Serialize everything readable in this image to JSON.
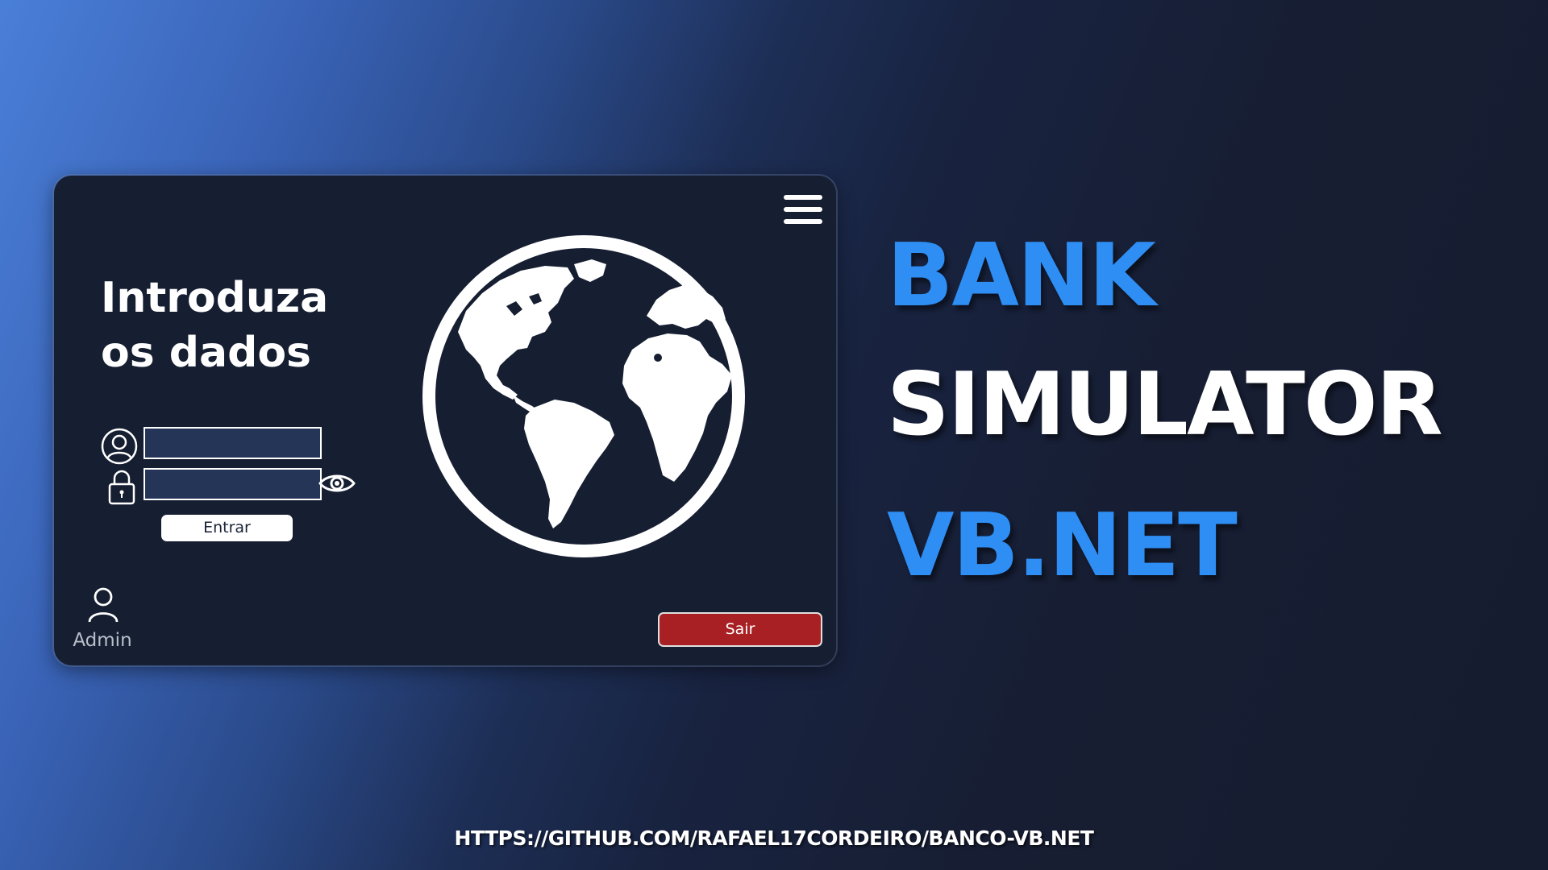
{
  "login_window": {
    "title_line1": "Introduza",
    "title_line2": "os dados",
    "username_value": "",
    "password_value": "",
    "enter_button": "Entrar",
    "admin_label": "Admin",
    "exit_button": "Sair",
    "icons": {
      "menu": "hamburger-menu-icon",
      "username": "user-circle-icon",
      "password": "padlock-icon",
      "show_password": "eye-icon",
      "illustration": "globe-icon",
      "admin": "person-icon"
    }
  },
  "headline": {
    "line1": "BANK",
    "line2": "SIMULATOR",
    "line3": "VB.NET"
  },
  "footer": {
    "url": "HTTPS://GITHUB.COM/RAFAEL17CORDEIRO/BANCO-VB.NET"
  },
  "colors": {
    "accent_blue": "#2e8ef4",
    "window_bg": "#161e31",
    "input_bg": "#253558",
    "exit_red": "#a82024"
  }
}
